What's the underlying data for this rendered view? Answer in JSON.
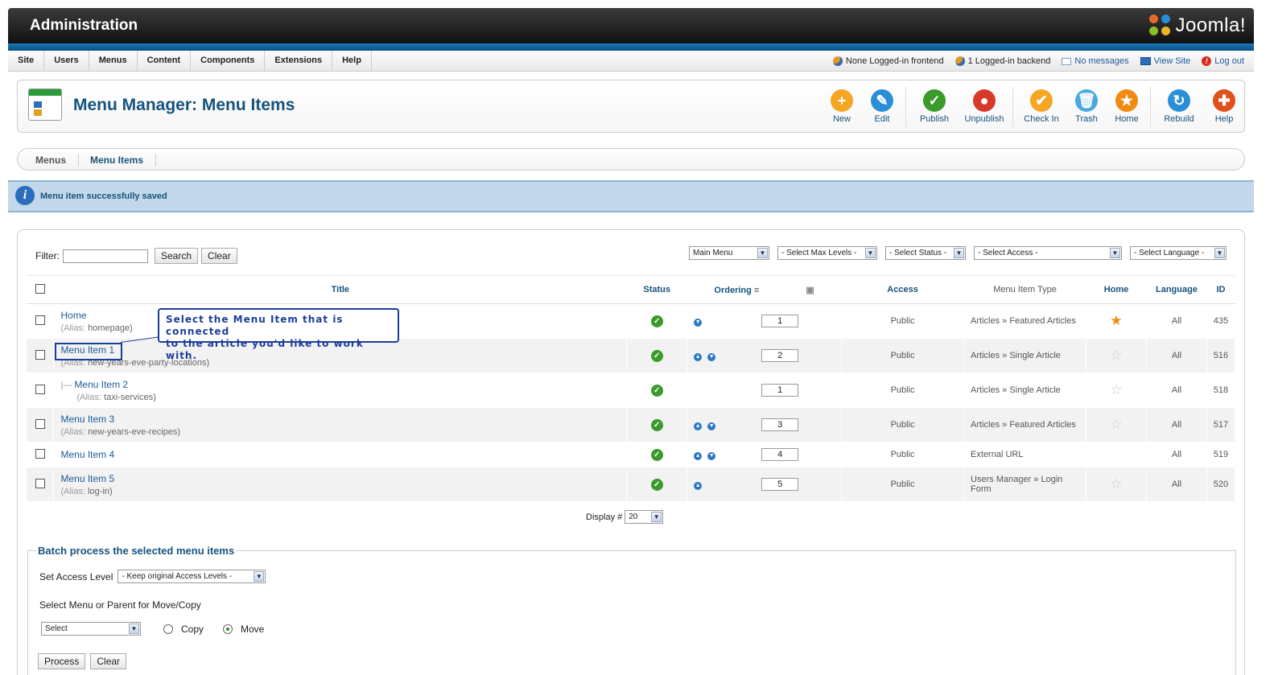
{
  "header": {
    "title": "Administration",
    "logo_text": "Joomla!"
  },
  "menubar": {
    "items": [
      "Site",
      "Users",
      "Menus",
      "Content",
      "Components",
      "Extensions",
      "Help"
    ],
    "status": {
      "frontend": "None Logged-in frontend",
      "backend": "1 Logged-in backend",
      "messages": "No messages",
      "view_site": "View Site",
      "logout": "Log out"
    }
  },
  "toolbar": {
    "page_title": "Menu Manager: Menu Items",
    "buttons": [
      {
        "label": "New",
        "color": "#f5a623",
        "glyph": "+"
      },
      {
        "label": "Edit",
        "color": "#2b8fd8",
        "glyph": "✎"
      },
      {
        "label": "Publish",
        "color": "#3a9a2a",
        "glyph": "✓"
      },
      {
        "label": "Unpublish",
        "color": "#d83a2a",
        "glyph": "●"
      },
      {
        "label": "Check In",
        "color": "#f5a623",
        "glyph": "✔"
      },
      {
        "label": "Trash",
        "color": "#4aa8e0",
        "glyph": "🗑"
      },
      {
        "label": "Home",
        "color": "#f08a10",
        "glyph": "★"
      },
      {
        "label": "Rebuild",
        "color": "#2b8fd8",
        "glyph": "↻"
      },
      {
        "label": "Help",
        "color": "#e0501a",
        "glyph": "✚"
      }
    ]
  },
  "submenu": {
    "menus": "Menus",
    "menu_items": "Menu Items"
  },
  "message": {
    "text": "Menu item successfully saved"
  },
  "filter": {
    "label": "Filter:",
    "value": "",
    "search_label": "Search",
    "clear_label": "Clear",
    "selects": [
      "Main Menu",
      "- Select Max Levels -",
      "- Select Status -",
      "- Select Access -",
      "- Select Language -"
    ]
  },
  "table": {
    "headers": {
      "title": "Title",
      "status": "Status",
      "ordering": "Ordering",
      "access": "Access",
      "type": "Menu Item Type",
      "home": "Home",
      "language": "Language",
      "id": "ID"
    },
    "alias_label": "(Alias:",
    "rows": [
      {
        "title": "Home",
        "alias": "homepage)",
        "order": "1",
        "access": "Public",
        "type": "Articles » Featured Articles",
        "home": true,
        "language": "All",
        "id": "435"
      },
      {
        "title": "Menu Item 1",
        "alias": "new-years-eve-party-locations)",
        "order": "2",
        "access": "Public",
        "type": "Articles » Single Article",
        "home": false,
        "language": "All",
        "id": "516"
      },
      {
        "title": "Menu Item 2",
        "alias": "taxi-services)",
        "order": "1",
        "access": "Public",
        "type": "Articles » Single Article",
        "home": false,
        "language": "All",
        "id": "518"
      },
      {
        "title": "Menu Item 3",
        "alias": "new-years-eve-recipes)",
        "order": "3",
        "access": "Public",
        "type": "Articles » Featured Articles",
        "home": false,
        "language": "All",
        "id": "517"
      },
      {
        "title": "Menu Item 4",
        "alias": "",
        "order": "4",
        "access": "Public",
        "type": "External URL",
        "home": null,
        "language": "All",
        "id": "519"
      },
      {
        "title": "Menu Item 5",
        "alias": "log-in)",
        "order": "5",
        "access": "Public",
        "type": "Users Manager » Login Form",
        "home": false,
        "language": "All",
        "id": "520"
      }
    ]
  },
  "display": {
    "label": "Display #",
    "value": "20"
  },
  "callout": {
    "line1": "Select the Menu Item that is connected",
    "line2": "to the article you'd like to work with."
  },
  "batch": {
    "legend": "Batch process the selected menu items",
    "access_label": "Set Access Level",
    "access_value": "- Keep original Access Levels -",
    "move_label": "Select Menu or Parent for Move/Copy",
    "menu_value": "Select",
    "copy_label": "Copy",
    "move_option": "Move",
    "process_label": "Process",
    "clear_label": "Clear"
  }
}
